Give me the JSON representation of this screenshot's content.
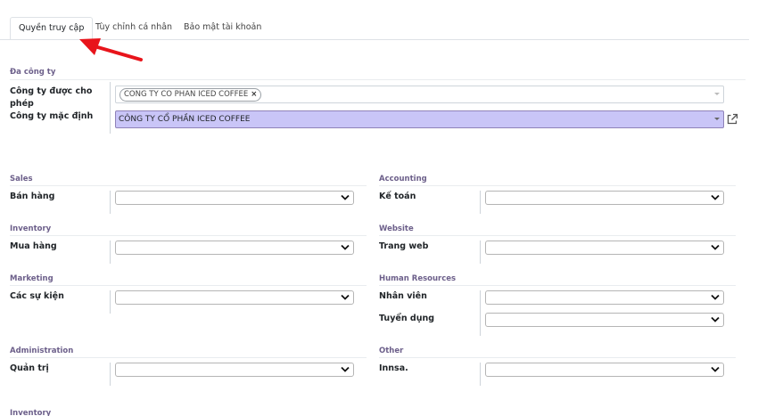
{
  "tabs": [
    {
      "label": "Quyền truy cập",
      "active": true
    },
    {
      "label": "Tùy chỉnh cá nhân",
      "active": false
    },
    {
      "label": "Bảo mật tài khoản",
      "active": false
    }
  ],
  "multi_company": {
    "section": "Đa công ty",
    "allowed_label": "Công ty được cho phép",
    "allowed_tag": "CONG TY CO PHAN ICED COFFEE",
    "default_label": "Công ty mặc định",
    "default_value": "CÔNG TY CỔ PHẦN ICED COFFEE"
  },
  "groups": {
    "sales": {
      "section": "Sales",
      "field": "Bán hàng"
    },
    "accounting": {
      "section": "Accounting",
      "field": "Kế toán"
    },
    "inventory": {
      "section": "Inventory",
      "field": "Mua hàng"
    },
    "website": {
      "section": "Website",
      "field": "Trang web"
    },
    "marketing": {
      "section": "Marketing",
      "field": "Các sự kiện"
    },
    "hr": {
      "section": "Human Resources",
      "field1": "Nhân viên",
      "field2": "Tuyển dụng"
    },
    "administration": {
      "section": "Administration",
      "field": "Quản trị"
    },
    "other": {
      "section": "Other",
      "field": "Innsa."
    },
    "inventory2": {
      "section": "Inventory"
    }
  },
  "colors": {
    "section_text": "#6c5f8a",
    "highlight_field": "#c9c5f7",
    "annotation_arrow": "#e8141b"
  }
}
